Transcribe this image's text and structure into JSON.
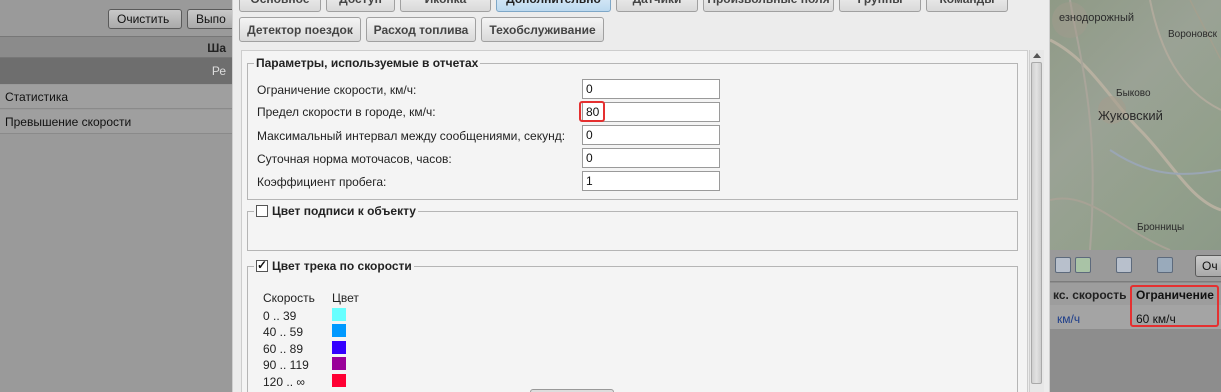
{
  "left_panel": {
    "clear_button": "Очистить",
    "second_button": "Выпо",
    "header_partial": "Ша",
    "sub_partial": "Ре",
    "rows": [
      "Статистика",
      "Превышение скорости"
    ]
  },
  "tabs": {
    "top": [
      "Основное",
      "Доступ",
      "Иконка",
      "Дополнительно",
      "Датчики",
      "Произвольные поля",
      "Группы",
      "Команды"
    ],
    "second": [
      "Детектор поездок",
      "Расход топлива",
      "Техобслуживание"
    ],
    "active": "Дополнительно"
  },
  "report_params": {
    "legend": "Параметры, используемые в отчетах",
    "fields": [
      {
        "label": "Ограничение скорости, км/ч:",
        "value": "0"
      },
      {
        "label": "Предел скорости в городе, км/ч:",
        "value": "80"
      },
      {
        "label": "Максимальный интервал между сообщениями, секунд:",
        "value": "0"
      },
      {
        "label": "Суточная норма моточасов, часов:",
        "value": "0"
      },
      {
        "label": "Коэффициент пробега:",
        "value": "1"
      }
    ]
  },
  "label_color": {
    "legend": "Цвет подписи к объекту",
    "checked": false
  },
  "track_color": {
    "legend": "Цвет трека по скорости",
    "checked": true,
    "check_glyph": "✓",
    "head_speed": "Скорость",
    "head_color": "Цвет",
    "ranges": [
      {
        "range": "0 .. 39",
        "color": "#66ffff"
      },
      {
        "range": "40 .. 59",
        "color": "#0099ff"
      },
      {
        "range": "60 .. 89",
        "color": "#3300ff"
      },
      {
        "range": "90 .. 119",
        "color": "#990099"
      },
      {
        "range": "120 .. ∞",
        "color": "#ff0033"
      }
    ]
  },
  "map": {
    "labels": [
      "езнодорожный",
      "Вороновск",
      "Быково",
      "Жуковский",
      "Бронницы"
    ]
  },
  "right_panel": {
    "button_partial": "Оч",
    "col_speed_head": "кс. скорость",
    "col_speed_value": "км/ч",
    "col_limit_head": "Ограничение",
    "col_limit_value": "60 км/ч"
  }
}
